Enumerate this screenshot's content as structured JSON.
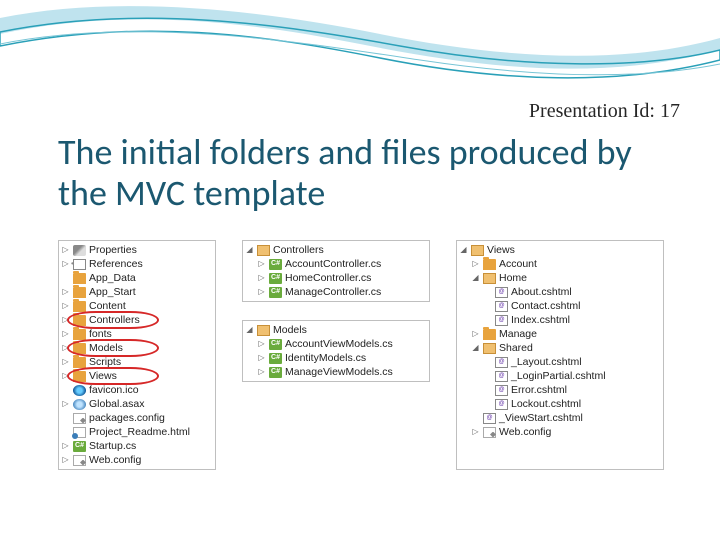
{
  "header": {
    "presentation_label": "Presentation Id: 17",
    "title": "The initial folders and files produced by the MVC template"
  },
  "glyphs": {
    "collapsed": "▷",
    "expanded": "◢"
  },
  "tree_left": {
    "items": [
      {
        "icon": "wrench",
        "arrow": "collapsed",
        "label": "Properties"
      },
      {
        "icon": "refs",
        "arrow": "collapsed",
        "label": "References"
      },
      {
        "icon": "folder",
        "arrow": "",
        "label": "App_Data"
      },
      {
        "icon": "folder",
        "arrow": "collapsed",
        "label": "App_Start"
      },
      {
        "icon": "folder",
        "arrow": "collapsed",
        "label": "Content"
      },
      {
        "icon": "folder",
        "arrow": "collapsed",
        "label": "Controllers",
        "circled": true
      },
      {
        "icon": "folder",
        "arrow": "collapsed",
        "label": "fonts"
      },
      {
        "icon": "folder",
        "arrow": "collapsed",
        "label": "Models",
        "circled": true
      },
      {
        "icon": "folder",
        "arrow": "collapsed",
        "label": "Scripts"
      },
      {
        "icon": "folder",
        "arrow": "collapsed",
        "label": "Views",
        "circled": true
      },
      {
        "icon": "ico",
        "arrow": "",
        "label": "favicon.ico"
      },
      {
        "icon": "globe",
        "arrow": "collapsed",
        "label": "Global.asax"
      },
      {
        "icon": "config",
        "arrow": "",
        "label": "packages.config"
      },
      {
        "icon": "html",
        "arrow": "",
        "label": "Project_Readme.html"
      },
      {
        "icon": "cs",
        "arrow": "collapsed",
        "label": "Startup.cs"
      },
      {
        "icon": "config",
        "arrow": "collapsed",
        "label": "Web.config"
      }
    ]
  },
  "tree_controllers": {
    "header": {
      "icon": "folder-open",
      "arrow": "expanded",
      "label": "Controllers"
    },
    "items": [
      {
        "icon": "cs",
        "arrow": "collapsed",
        "label": "AccountController.cs"
      },
      {
        "icon": "cs",
        "arrow": "collapsed",
        "label": "HomeController.cs"
      },
      {
        "icon": "cs",
        "arrow": "collapsed",
        "label": "ManageController.cs"
      }
    ]
  },
  "tree_models": {
    "header": {
      "icon": "folder-open",
      "arrow": "expanded",
      "label": "Models"
    },
    "items": [
      {
        "icon": "cs",
        "arrow": "collapsed",
        "label": "AccountViewModels.cs"
      },
      {
        "icon": "cs",
        "arrow": "collapsed",
        "label": "IdentityModels.cs"
      },
      {
        "icon": "cs",
        "arrow": "collapsed",
        "label": "ManageViewModels.cs"
      }
    ]
  },
  "tree_views": {
    "header": {
      "icon": "folder-open",
      "arrow": "expanded",
      "label": "Views"
    },
    "items": [
      {
        "indent": 1,
        "icon": "folder",
        "arrow": "collapsed",
        "label": "Account"
      },
      {
        "indent": 1,
        "icon": "folder-open",
        "arrow": "expanded",
        "label": "Home"
      },
      {
        "indent": 2,
        "icon": "cshtml",
        "arrow": "",
        "label": "About.cshtml"
      },
      {
        "indent": 2,
        "icon": "cshtml",
        "arrow": "",
        "label": "Contact.cshtml"
      },
      {
        "indent": 2,
        "icon": "cshtml",
        "arrow": "",
        "label": "Index.cshtml"
      },
      {
        "indent": 1,
        "icon": "folder",
        "arrow": "collapsed",
        "label": "Manage"
      },
      {
        "indent": 1,
        "icon": "folder-open",
        "arrow": "expanded",
        "label": "Shared"
      },
      {
        "indent": 2,
        "icon": "cshtml",
        "arrow": "",
        "label": "_Layout.cshtml"
      },
      {
        "indent": 2,
        "icon": "cshtml",
        "arrow": "",
        "label": "_LoginPartial.cshtml"
      },
      {
        "indent": 2,
        "icon": "cshtml",
        "arrow": "",
        "label": "Error.cshtml"
      },
      {
        "indent": 2,
        "icon": "cshtml",
        "arrow": "",
        "label": "Lockout.cshtml"
      },
      {
        "indent": 1,
        "icon": "cshtml",
        "arrow": "",
        "label": "_ViewStart.cshtml"
      },
      {
        "indent": 1,
        "icon": "config",
        "arrow": "collapsed",
        "label": "Web.config"
      }
    ]
  }
}
